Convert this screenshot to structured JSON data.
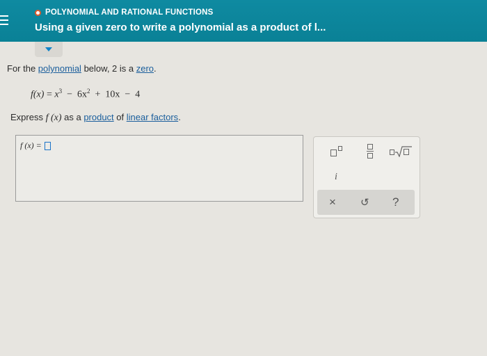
{
  "header": {
    "kicker": "POLYNOMIAL AND RATIONAL FUNCTIONS",
    "title": "Using a given zero to write a polynomial as a product of l..."
  },
  "question": {
    "line1_prefix": "For the ",
    "line1_link1": "polynomial",
    "line1_mid": " below, 2 is a ",
    "line1_link2": "zero",
    "line1_end": ".",
    "formula": {
      "lhs": "f(x)",
      "eq": "=",
      "t1": "x",
      "t1_exp": "3",
      "op1": "−",
      "t2": "6x",
      "t2_exp": "2",
      "op2": "+",
      "t3": "10x",
      "op3": "−",
      "t4": "4"
    },
    "line2_prefix": "Express ",
    "line2_func": "f (x)",
    "line2_mid": " as a ",
    "line2_link1": "product",
    "line2_mid2": " of ",
    "line2_link2": "linear factors",
    "line2_end": "."
  },
  "answer": {
    "prefix": "f (x) ="
  },
  "palette": {
    "imag_label": "i",
    "clear_label": "×",
    "undo_label": "↺",
    "help_label": "?"
  },
  "colors": {
    "header_bg": "#0a8196",
    "link": "#1a5e9c",
    "accent_blue": "#1083c9"
  }
}
